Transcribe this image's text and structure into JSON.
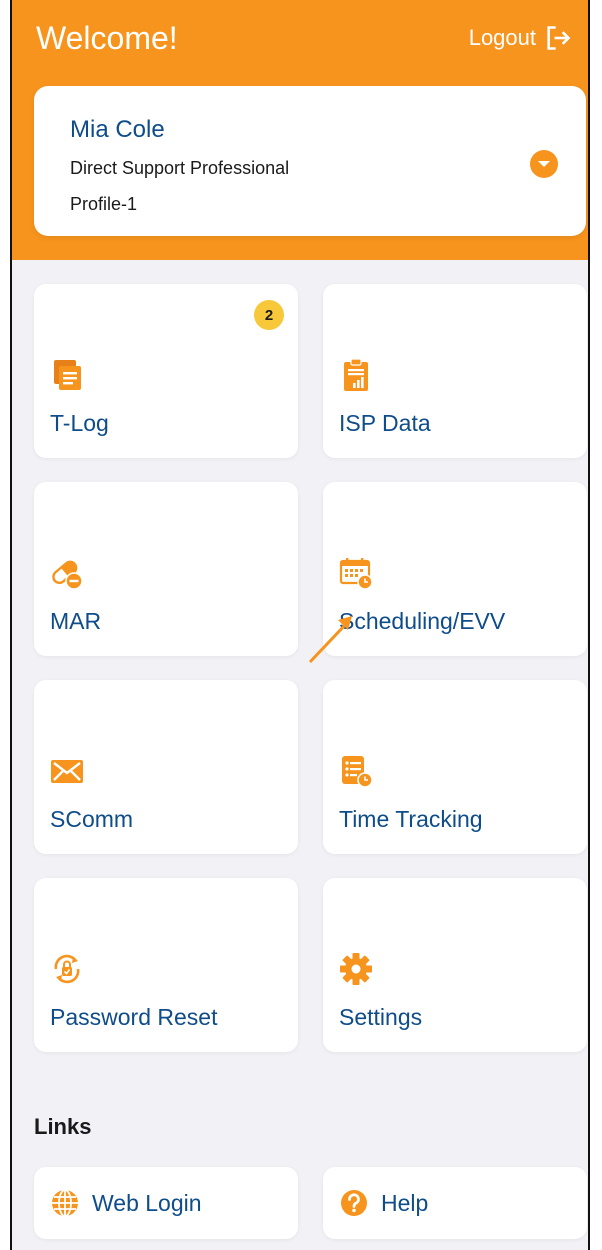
{
  "header": {
    "welcome": "Welcome!",
    "logout_label": "Logout",
    "accent": "#f7941d"
  },
  "profile": {
    "name": "Mia Cole",
    "role": "Direct Support Professional",
    "profile_id": "Profile-1"
  },
  "tiles": [
    {
      "label": "T-Log",
      "icon": "notes-icon",
      "badge": "2"
    },
    {
      "label": "ISP Data",
      "icon": "clipboard-chart-icon"
    },
    {
      "label": "MAR",
      "icon": "pill-icon"
    },
    {
      "label": "Scheduling/EVV",
      "icon": "calendar-clock-icon"
    },
    {
      "label": "SComm",
      "icon": "envelope-icon"
    },
    {
      "label": "Time Tracking",
      "icon": "checklist-clock-icon"
    },
    {
      "label": "Password Reset",
      "icon": "lock-reset-icon"
    },
    {
      "label": "Settings",
      "icon": "gear-icon"
    }
  ],
  "links": {
    "title": "Links",
    "items": [
      {
        "label": "Web Login",
        "icon": "globe-icon"
      },
      {
        "label": "Help",
        "icon": "help-icon"
      }
    ]
  },
  "colors": {
    "label_blue": "#0e4c8a",
    "badge_yellow": "#f7c93a",
    "background": "#f2f2f6"
  }
}
